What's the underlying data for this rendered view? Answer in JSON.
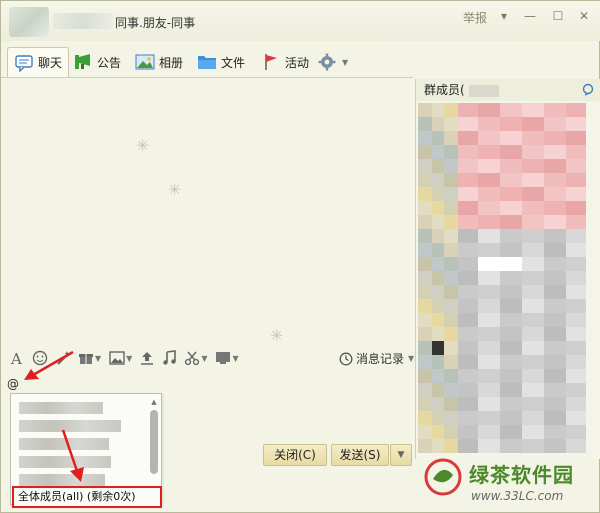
{
  "window": {
    "title": "同事.朋友-同事",
    "report_label": "举报",
    "controls": {
      "dropdown": "▾",
      "minimize": "—",
      "maximize": "☐",
      "close": "✕"
    }
  },
  "tabs": [
    {
      "label": "聊天",
      "icon": "chat-bubble-icon",
      "active": true
    },
    {
      "label": "公告",
      "icon": "megaphone-icon",
      "active": false
    },
    {
      "label": "相册",
      "icon": "photo-icon",
      "active": false
    },
    {
      "label": "文件",
      "icon": "folder-icon",
      "active": false
    },
    {
      "label": "活动",
      "icon": "flag-icon",
      "active": false
    },
    {
      "label": "",
      "icon": "gear-icon",
      "active": false
    }
  ],
  "input_toolbar": {
    "tools": [
      "font-icon",
      "emoji-icon",
      "magic-wand-icon",
      "gift-icon",
      "image-icon",
      "upload-icon",
      "music-note-icon",
      "scissors-icon",
      "screen-share-icon"
    ],
    "history_label": "消息记录"
  },
  "input": {
    "text": "@"
  },
  "mention_popup": {
    "all_members_label": "全体成员(all) (剩余0次)"
  },
  "buttons": {
    "close_label": "关闭(C)",
    "send_label": "发送(S)"
  },
  "members_panel": {
    "header_label": "群成员("
  },
  "watermark": {
    "brand": "绿茶软件园",
    "url": "www.33LC.com"
  },
  "colors": {
    "highlight_red": "#e02020",
    "watermark_green": "#4b8a2a",
    "background": "#f4f4e6"
  }
}
